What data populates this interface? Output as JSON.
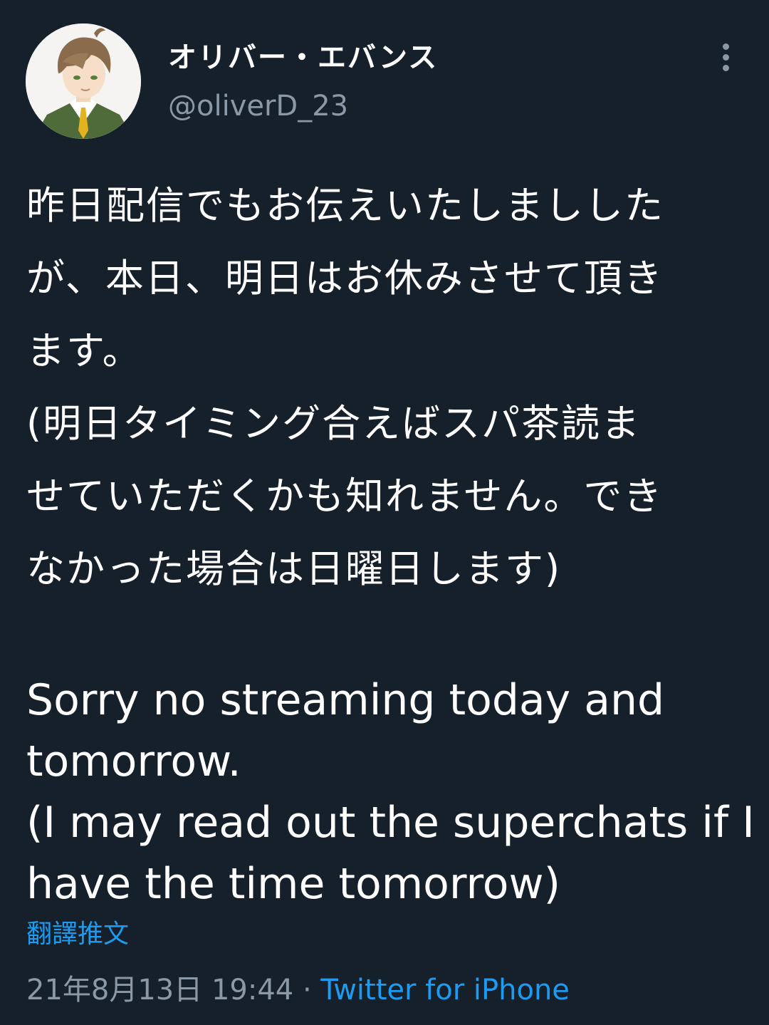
{
  "tweet": {
    "author": {
      "display_name": "オリバー・エバンス",
      "handle": "@oliverD_23",
      "avatar_icon": "avatar-illustration-icon"
    },
    "more_icon": "more-vertical-icon",
    "text_lines_jp": [
      "昨日配信でもお伝えいたしましした",
      "が、本日、明日はお休みさせて頂き",
      "ます。",
      "(明日タイミング合えばスパ茶読ま",
      "せていただくかも知れません。でき",
      "なかった場合は日曜日します)"
    ],
    "text_lines_en": [
      "Sorry no streaming today and",
      "tomorrow.",
      "(I may read out the superchats if I",
      "have the time tomorrow)"
    ],
    "translate_label": "翻譯推文",
    "timestamp": "21年8月13日 19:44",
    "separator": "·",
    "source": "Twitter for iPhone"
  },
  "colors": {
    "background": "#15202b",
    "text": "#ffffff",
    "secondary": "#8b98a5",
    "link": "#1d9bf0"
  }
}
